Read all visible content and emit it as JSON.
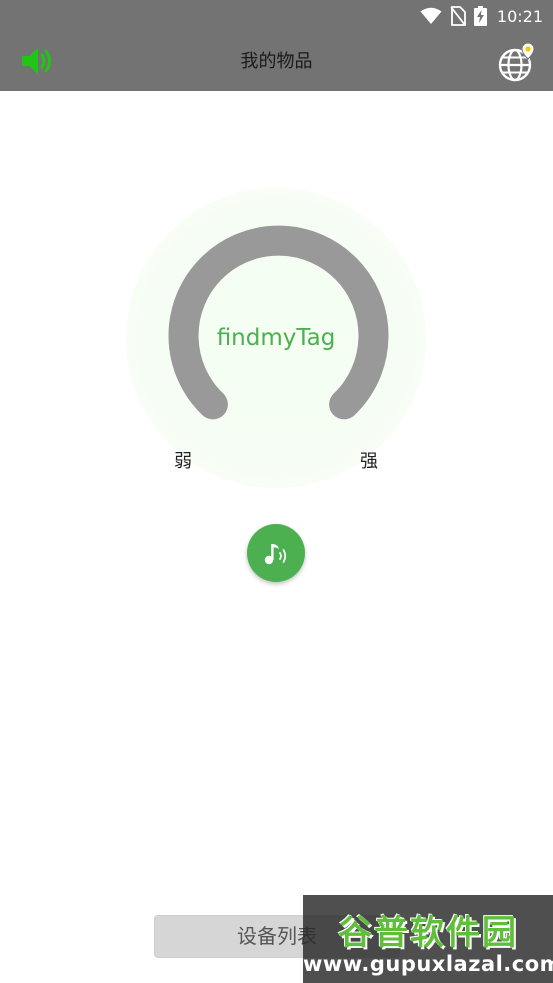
{
  "status_bar": {
    "time": "10:21",
    "icons": [
      "wifi-icon",
      "no-sim-icon",
      "battery-charging-icon"
    ]
  },
  "app_bar": {
    "title": "我的物品",
    "left_icon": "speaker-volume-icon",
    "right_icon": "globe-location-icon",
    "accent_color": "#22c418"
  },
  "signal": {
    "device_name": "findmyTag",
    "weak_label": "弱",
    "strong_label": "强",
    "name_color": "#4caf50",
    "gauge_color": "#999999"
  },
  "ring_button": {
    "icon": "music-note-sound-icon",
    "color": "#4caf50"
  },
  "footer": {
    "device_list_label": "设备列表"
  },
  "watermark": {
    "brand": "谷普软件园",
    "url": "www.gupuxlazal.com"
  }
}
